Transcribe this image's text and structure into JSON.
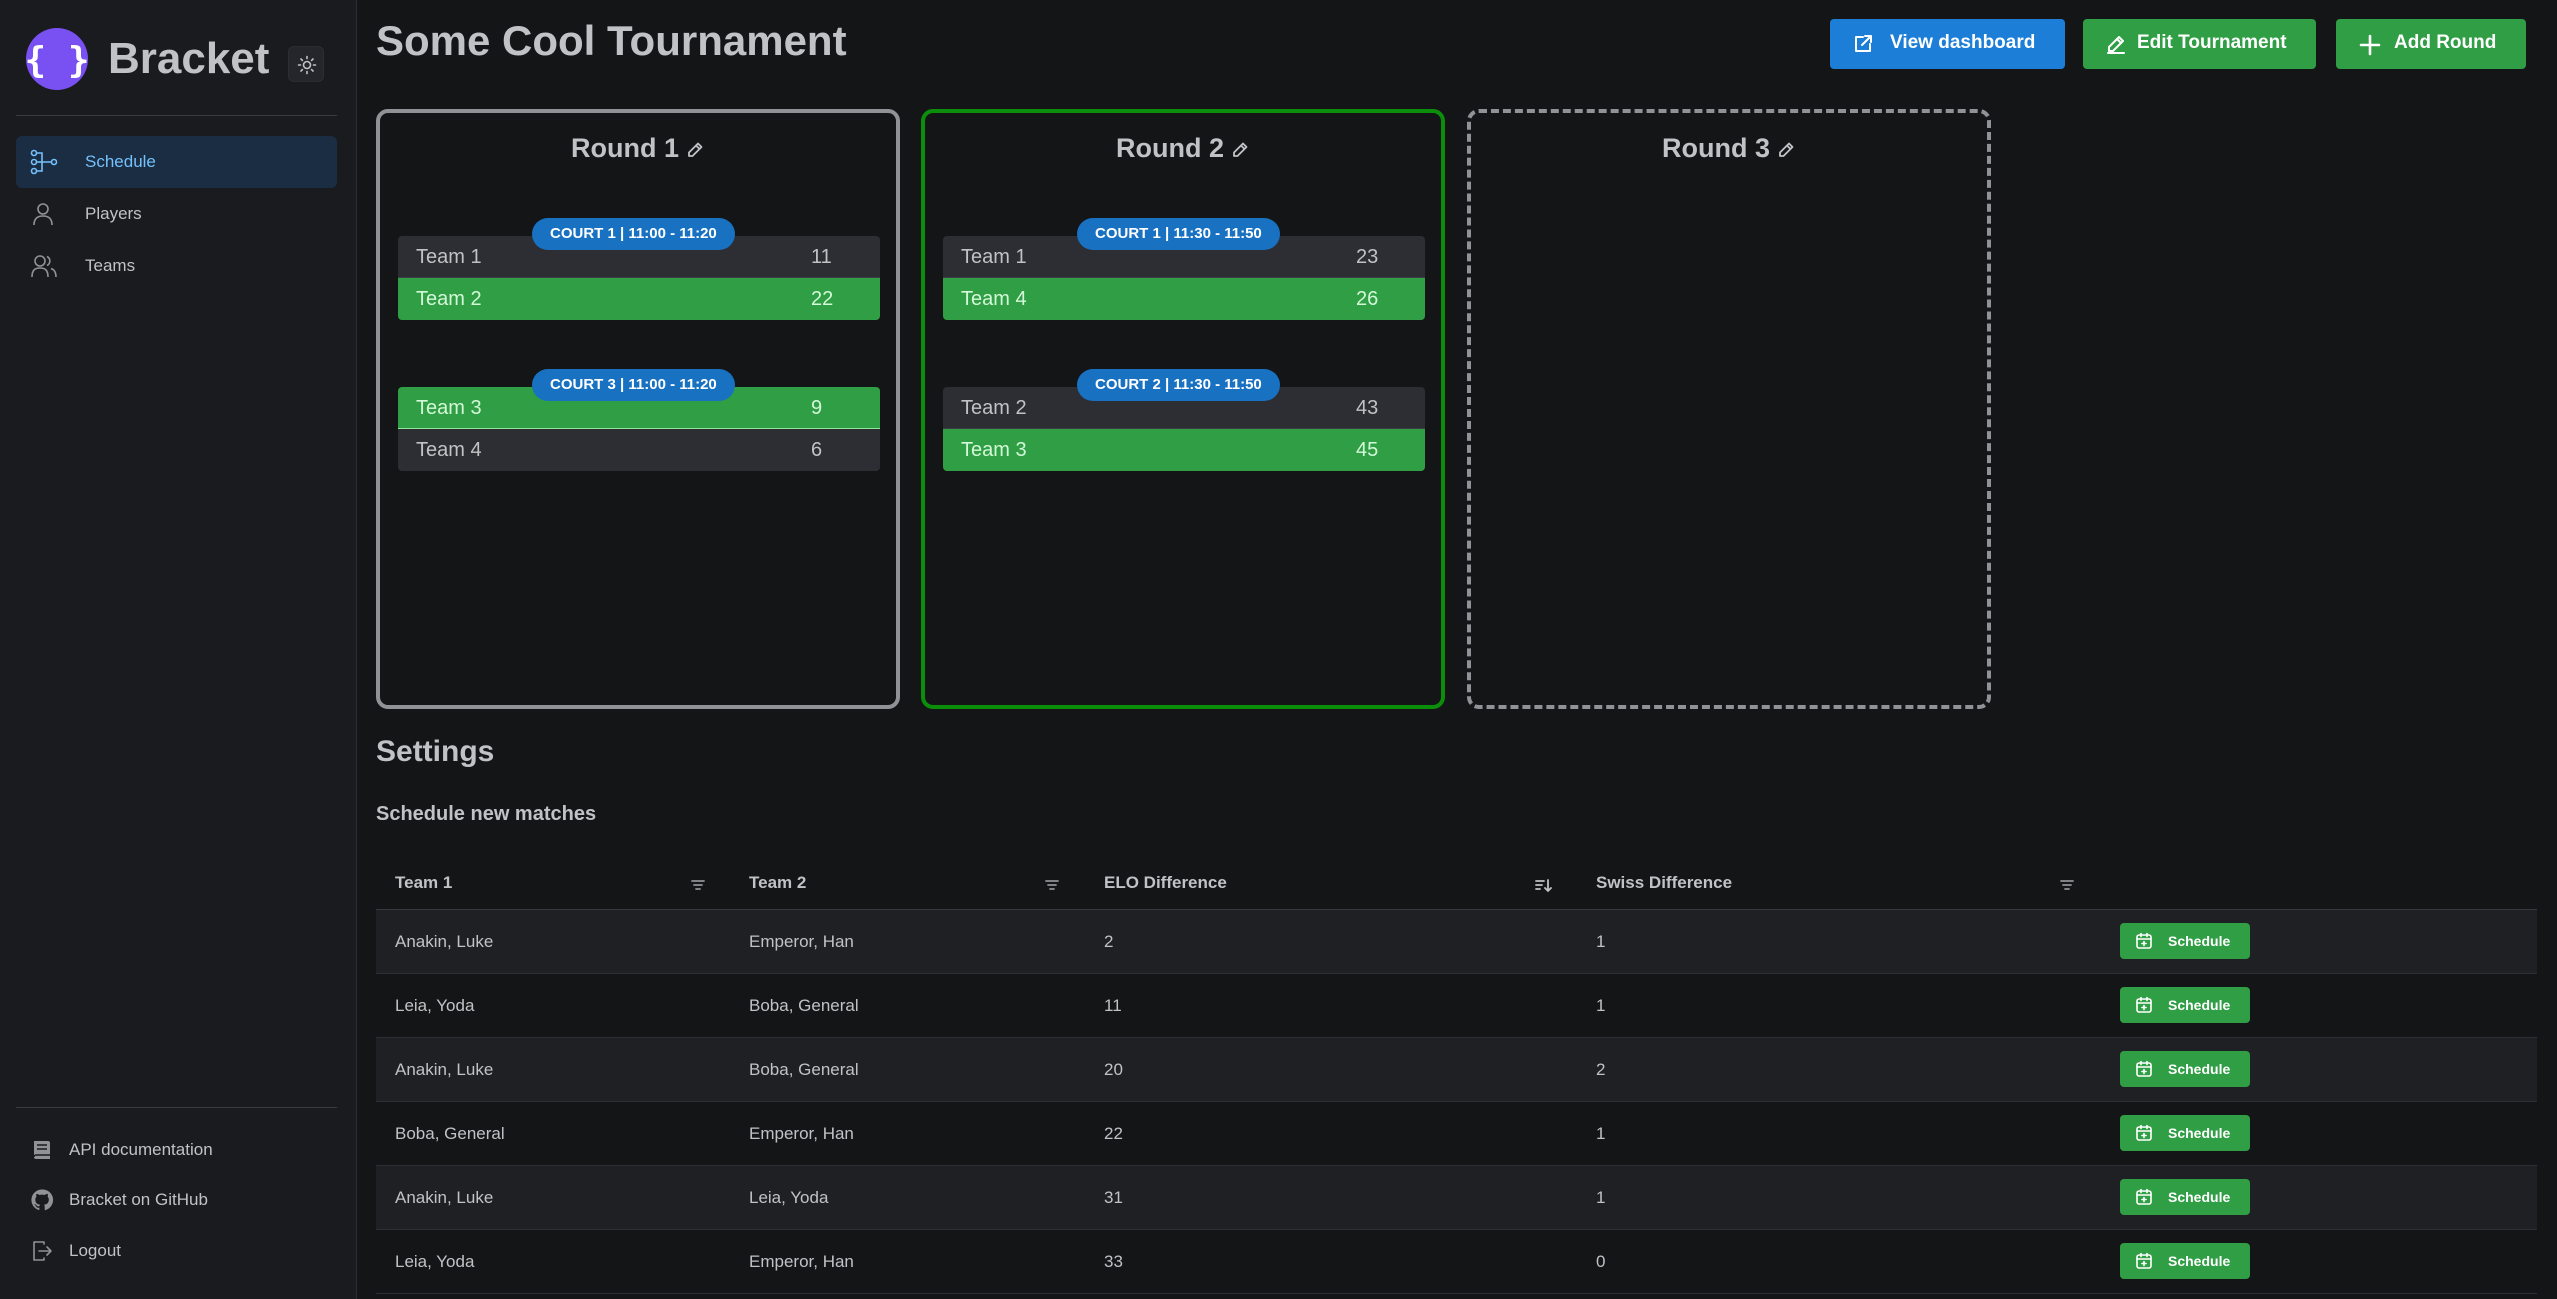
{
  "app": {
    "name": "Bracket",
    "brand_color": "#7950f2"
  },
  "sidebar": {
    "items": [
      {
        "label": "Schedule",
        "icon": "schedule-tree-icon",
        "active": true
      },
      {
        "label": "Players",
        "icon": "user-icon",
        "active": false
      },
      {
        "label": "Teams",
        "icon": "users-icon",
        "active": false
      }
    ],
    "footer": [
      {
        "label": "API documentation",
        "icon": "book-icon"
      },
      {
        "label": "Bracket on GitHub",
        "icon": "github-icon"
      },
      {
        "label": "Logout",
        "icon": "logout-icon"
      }
    ]
  },
  "header": {
    "title": "Some Cool Tournament",
    "buttons": {
      "view_dashboard": "View dashboard",
      "edit_tournament": "Edit Tournament",
      "add_round": "Add Round"
    }
  },
  "rounds": [
    {
      "title": "Round 1",
      "state": "finished",
      "matches": [
        {
          "badge": "COURT 1 | 11:00 - 11:20",
          "team1": {
            "name": "Team 1",
            "score": "11",
            "win": false
          },
          "team2": {
            "name": "Team 2",
            "score": "22",
            "win": true
          }
        },
        {
          "badge": "COURT 3 | 11:00 - 11:20",
          "team1": {
            "name": "Team 3",
            "score": "9",
            "win": true
          },
          "team2": {
            "name": "Team 4",
            "score": "6",
            "win": false
          }
        }
      ]
    },
    {
      "title": "Round 2",
      "state": "active",
      "matches": [
        {
          "badge": "COURT 1 | 11:30 - 11:50",
          "team1": {
            "name": "Team 1",
            "score": "23",
            "win": false
          },
          "team2": {
            "name": "Team 4",
            "score": "26",
            "win": true
          }
        },
        {
          "badge": "COURT 2 | 11:30 - 11:50",
          "team1": {
            "name": "Team 2",
            "score": "43",
            "win": false
          },
          "team2": {
            "name": "Team 3",
            "score": "45",
            "win": true
          }
        }
      ]
    },
    {
      "title": "Round 3",
      "state": "planned",
      "matches": []
    }
  ],
  "settings": {
    "title": "Settings",
    "subtitle": "Schedule new matches",
    "columns": [
      "Team 1",
      "Team 2",
      "ELO Difference",
      "Swiss Difference"
    ],
    "button_label": "Schedule",
    "rows": [
      {
        "team1": "Anakin, Luke",
        "team2": "Emperor, Han",
        "elo": "2",
        "swiss": "1"
      },
      {
        "team1": "Leia, Yoda",
        "team2": "Boba, General",
        "elo": "11",
        "swiss": "1"
      },
      {
        "team1": "Anakin, Luke",
        "team2": "Boba, General",
        "elo": "20",
        "swiss": "2"
      },
      {
        "team1": "Boba, General",
        "team2": "Emperor, Han",
        "elo": "22",
        "swiss": "1"
      },
      {
        "team1": "Anakin, Luke",
        "team2": "Leia, Yoda",
        "elo": "31",
        "swiss": "1"
      },
      {
        "team1": "Leia, Yoda",
        "team2": "Emperor, Han",
        "elo": "33",
        "swiss": "0"
      }
    ]
  },
  "colors": {
    "win": "#2f9e44",
    "badge": "#1971c2",
    "active_round_border": "#0b8f0b",
    "primary_button": "#1c7ed6"
  }
}
